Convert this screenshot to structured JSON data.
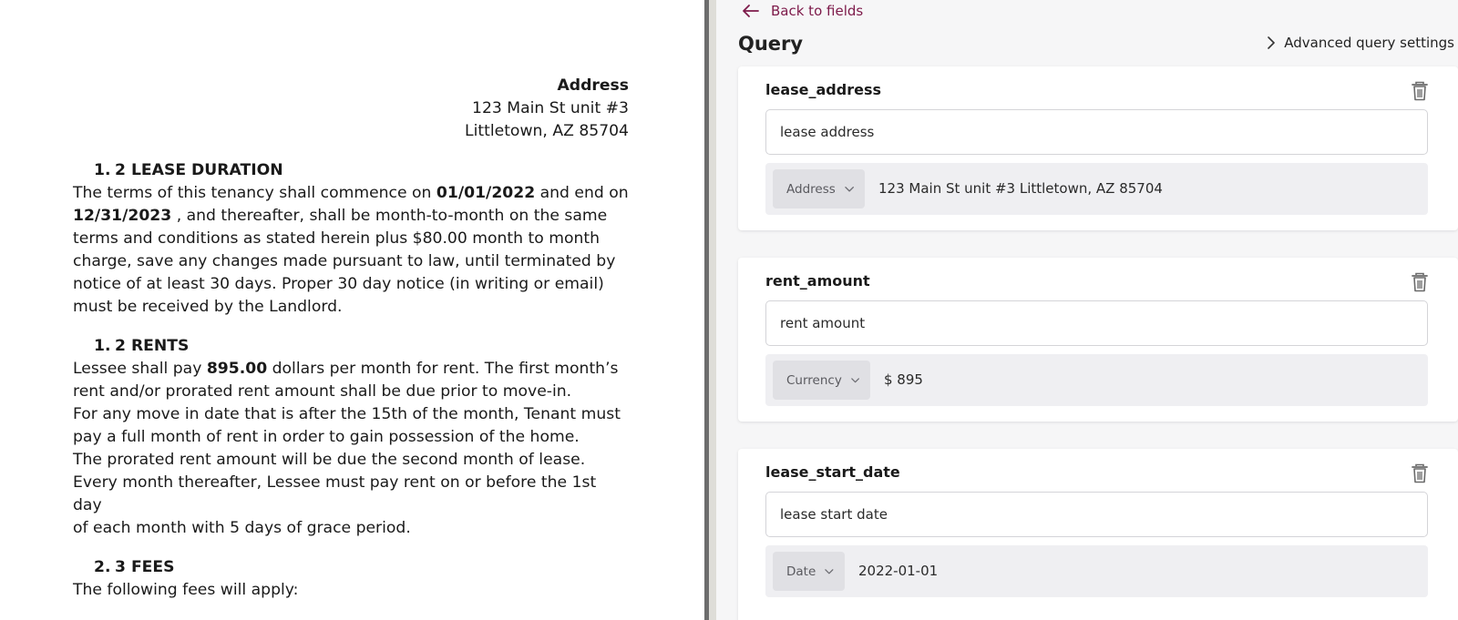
{
  "document": {
    "address_heading": "Address",
    "address_line1": "123 Main St unit #3",
    "address_line2": "Littletown, AZ 85704",
    "sections": [
      {
        "number": "1.",
        "title": "2 LEASE DURATION",
        "lines": [
          [
            "The terms of this tenancy shall commence on ",
            "01/01/2022",
            " and end on"
          ],
          [
            "",
            "12/31/2023",
            " , and thereafter, shall be month-to-month on the same"
          ],
          [
            "terms and conditions as stated herein plus $80.00 month to month"
          ],
          [
            "charge, save any changes made pursuant to law, until terminated by"
          ],
          [
            "notice of at least 30 days. Proper 30 day notice (in writing or email)"
          ],
          [
            "must be received by the Landlord."
          ]
        ]
      },
      {
        "number": "1.",
        "title": "2 RENTS",
        "lines": [
          [
            "Lessee shall pay ",
            "895.00",
            " dollars per month for rent. The first month’s"
          ],
          [
            "rent and/or prorated rent amount shall be due prior to move-in."
          ],
          [
            "For any move in date that is after the 15th of the month, Tenant must"
          ],
          [
            "pay a full month of rent in order to gain possession of the home."
          ],
          [
            "The prorated rent amount will be due the second month of lease."
          ],
          [
            "Every month thereafter, Lessee must pay rent on or before the 1st day"
          ],
          [
            "of each month with 5 days of grace period."
          ]
        ]
      },
      {
        "number": "2.",
        "title": "3 FEES",
        "lines": [
          [
            "The following fees will apply:"
          ]
        ]
      }
    ]
  },
  "query_panel": {
    "back_label": "Back to fields",
    "title": "Query",
    "advanced_label": "Advanced query settings",
    "fields": [
      {
        "name": "lease_address",
        "query": "lease address",
        "type": "Address",
        "value": "123 Main St unit #3 Littletown, AZ 85704"
      },
      {
        "name": "rent_amount",
        "query": "rent amount",
        "type": "Currency",
        "value": "$ 895"
      },
      {
        "name": "lease_start_date",
        "query": "lease start date",
        "type": "Date",
        "value": "2022-01-01"
      }
    ]
  },
  "colors": {
    "link": "#7d1a4a",
    "panel_bg": "#f6f6f7",
    "splitter": "#6c6c6c"
  },
  "icons": {
    "back": "arrow-left-icon",
    "advanced": "chevron-right-icon",
    "delete": "trash-icon",
    "dropdown": "chevron-down-icon"
  }
}
